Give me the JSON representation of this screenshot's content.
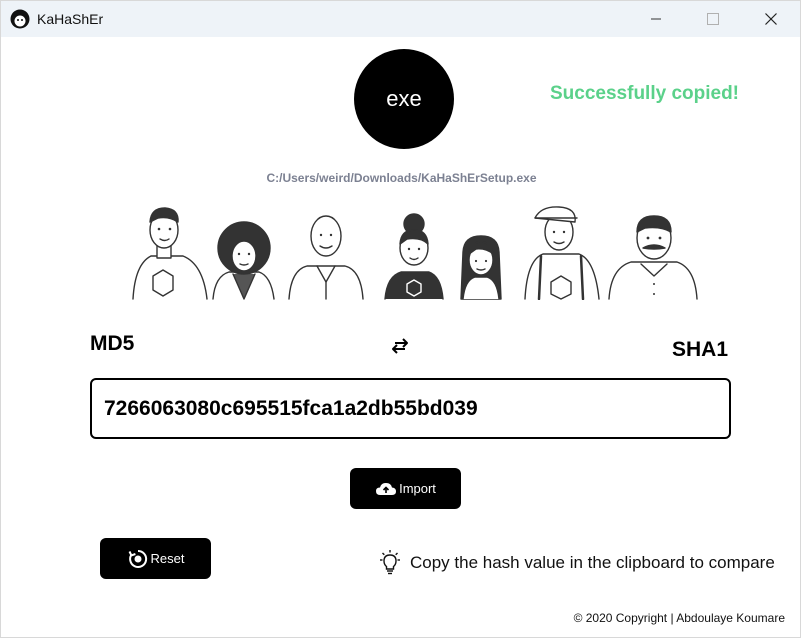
{
  "window": {
    "title": "KaHaShEr",
    "controls": {
      "minimize": "minimize-icon",
      "maximize": "maximize-icon",
      "close": "close-icon"
    }
  },
  "file": {
    "type_label": "exe",
    "path": "C:/Users/weird/Downloads/KaHaShErSetup.exe"
  },
  "status": {
    "message": "Successfully copied!",
    "color": "#5bd18a"
  },
  "hash": {
    "algorithm_left": "MD5",
    "algorithm_right": "SHA1",
    "swap_icon": "swap-arrows-icon",
    "value": "7266063080c695515fca1a2db55bd039"
  },
  "buttons": {
    "import_label": "Import",
    "import_icon": "cloud-upload-icon",
    "reset_label": "Reset",
    "reset_icon": "reset-icon"
  },
  "tip": {
    "icon": "lightbulb-icon",
    "text": "Copy the hash value in the clipboard to compare"
  },
  "footer": {
    "copyright": "© 2020 Copyright | Abdoulaye Koumare"
  },
  "illustration": {
    "icon": "people-group-illustration"
  }
}
